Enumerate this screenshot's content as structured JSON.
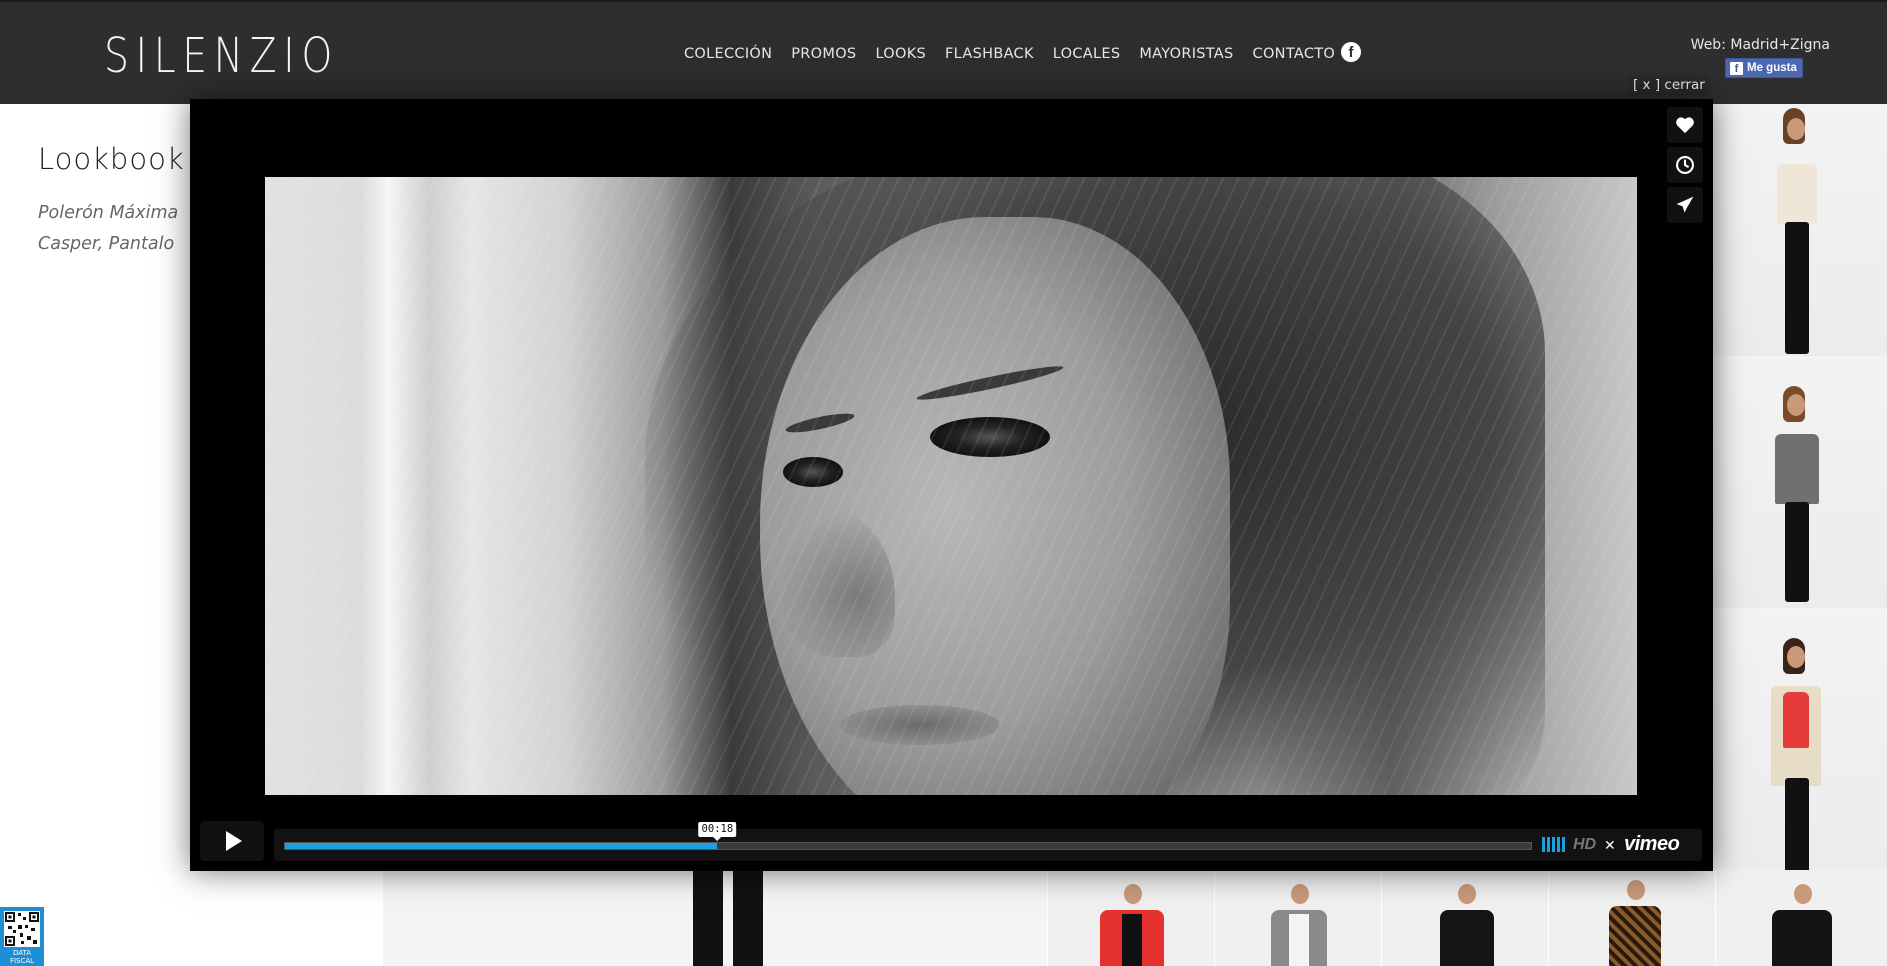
{
  "header": {
    "logo": "SILENZIO",
    "nav": [
      "COLECCIÓN",
      "PROMOS",
      "LOOKS",
      "FLASHBACK",
      "LOCALES",
      "MAYORISTAS",
      "CONTACTO"
    ],
    "facebook_icon": "facebook-icon",
    "web_credit": "Web: Madrid+Zigna",
    "like_button": "Me gusta"
  },
  "content": {
    "title": "Lookbook",
    "description_line1": "Polerón Máxima",
    "description_line2": "Casper, Pantalo"
  },
  "qr": {
    "label_line1": "DATA",
    "label_line2": "FISCAL"
  },
  "overlay": {
    "close_label": "[ x ] cerrar",
    "side_buttons": [
      "heart-icon",
      "clock-icon",
      "send-icon"
    ],
    "player": {
      "state": "paused",
      "time_tooltip": "00:18",
      "progress": 0.347,
      "hd_label": "HD",
      "brand": "vimeo",
      "accent_color": "#1a9fe0"
    }
  }
}
